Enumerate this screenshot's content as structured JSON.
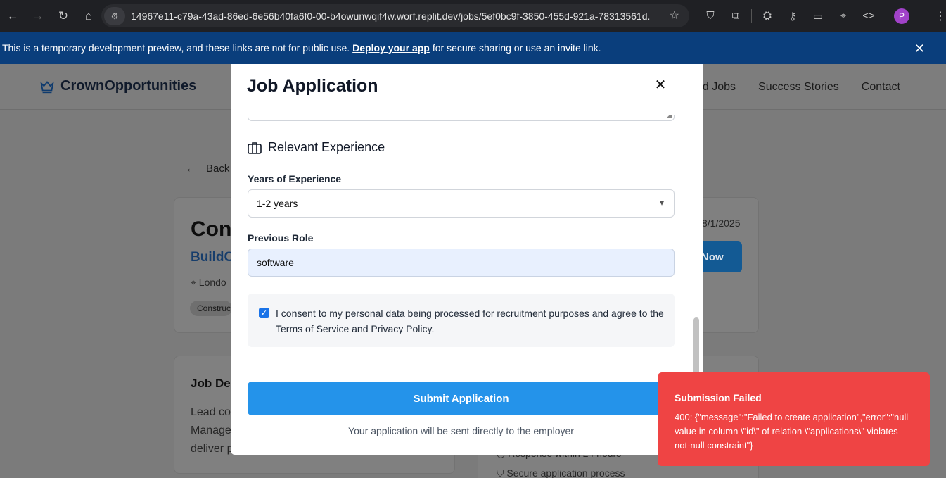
{
  "browser": {
    "url": "14967e11-c79a-43ad-86ed-6e56b40fa6f0-00-b4owunwqif4w.worf.replit.dev/jobs/5ef0bc9f-3850-455d-921a-78313561d...",
    "profile_initial": "P"
  },
  "banner": {
    "text_before": "This is a temporary development preview, and these links are not for public use.",
    "link": "Deploy your app",
    "text_after": "for secure sharing or use an invite link."
  },
  "site": {
    "brand": "CrownOpportunities",
    "nav": [
      "ad Jobs",
      "Success Stories",
      "Contact"
    ],
    "back_label": "Back",
    "job_title_partial": "Con",
    "company_partial": "BuildC",
    "location_partial": "Londo",
    "tag_partial": "Construct",
    "posted_partial": "8/1/2025",
    "apply_partial": "Now",
    "desc_title_partial": "Job De",
    "desc_lines": [
      "Lead co",
      "Manage",
      "deliver p"
    ],
    "side_items": [
      "Response within 24 hours",
      "Secure application process"
    ]
  },
  "modal": {
    "title": "Job Application",
    "section_title": "Relevant Experience",
    "years_label": "Years of Experience",
    "years_value": "1-2 years",
    "role_label": "Previous Role",
    "role_value": "software",
    "consent_text": "I consent to my personal data being processed for recruitment purposes and agree to the Terms of Service and Privacy Policy.",
    "consent_checked": true,
    "submit_label": "Submit Application",
    "helper_text": "Your application will be sent directly to the employer"
  },
  "toast": {
    "title": "Submission Failed",
    "message": "400: {\"message\":\"Failed to create application\",\"error\":\"null value in column \\\"id\\\" of relation \\\"applications\\\" violates not-null constraint\"}",
    "color": "#ef4444"
  }
}
